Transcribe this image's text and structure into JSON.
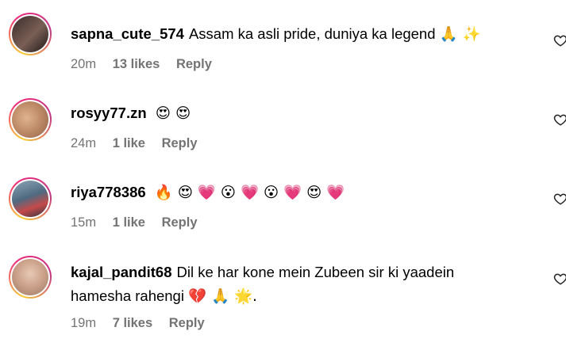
{
  "comments": [
    {
      "username": "sapna_cute_574",
      "text": "Assam ka asli pride, duniya ka legend",
      "emojis": "🙏 ✨",
      "time": "20m",
      "likes": "13 likes",
      "reply": "Reply"
    },
    {
      "username": "rosyy77.zn",
      "text": "",
      "emojis": "😍 😍",
      "time": "24m",
      "likes": "1 like",
      "reply": "Reply"
    },
    {
      "username": "riya778386",
      "text": "",
      "emojis": "🔥 😍 💗 😮 💗 😮 💗 😍 💗",
      "time": "15m",
      "likes": "1 like",
      "reply": "Reply"
    },
    {
      "username": "kajal_pandit68",
      "text": "Dil ke har kone mein Zubeen sir ki yaadein hamesha rahengi",
      "emojis": "💔 🙏 🌟.",
      "time": "19m",
      "likes": "7 likes",
      "reply": "Reply"
    }
  ],
  "icons": {
    "like": "heart-outline-icon"
  }
}
